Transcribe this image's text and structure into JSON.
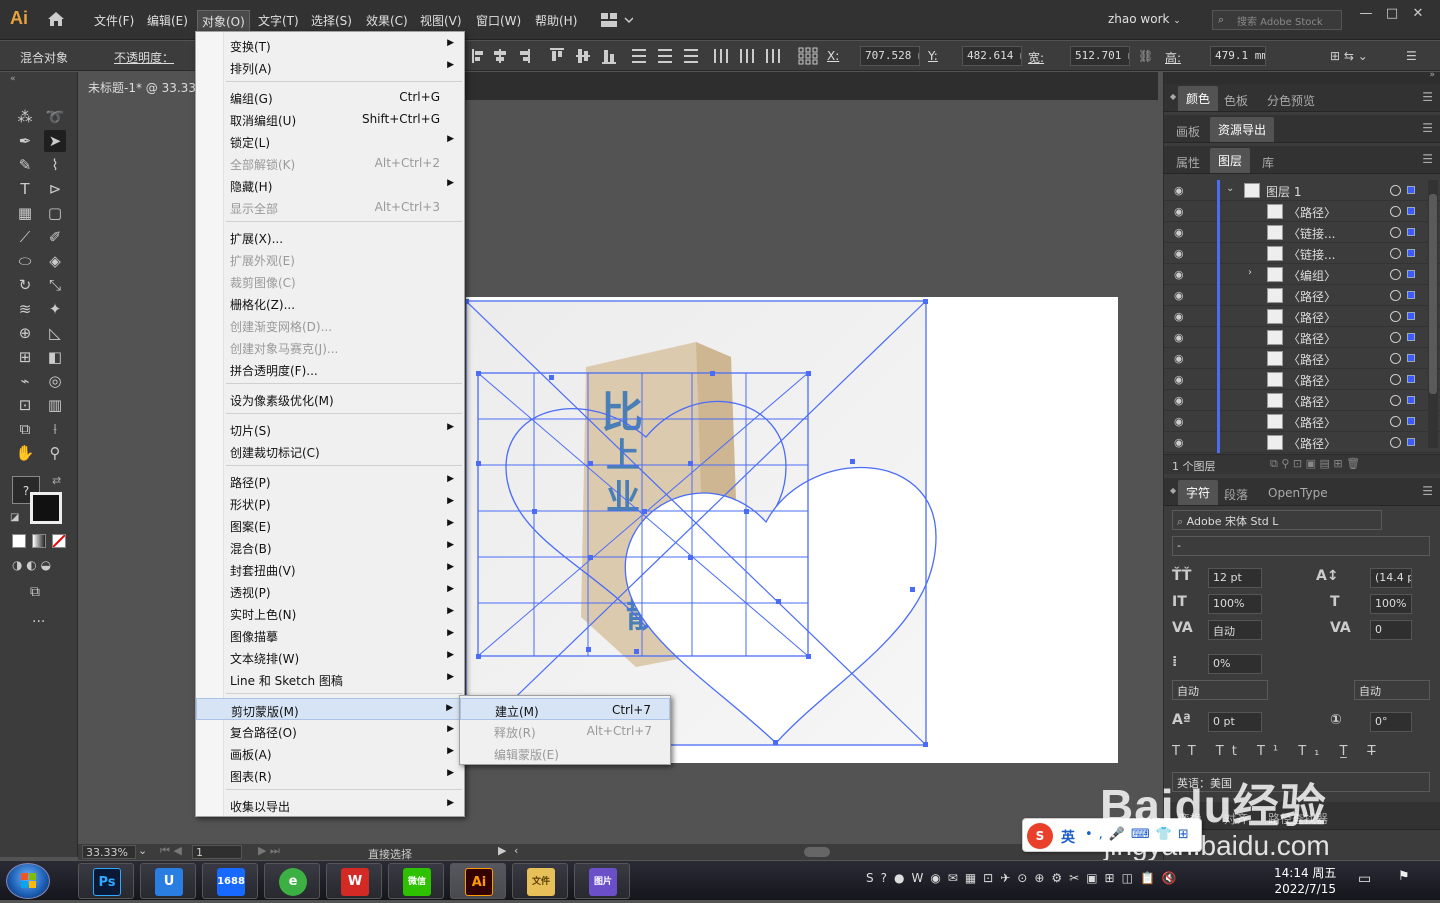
{
  "app": {
    "logo": "Ai",
    "menus": [
      "文件(F)",
      "编辑(E)",
      "对象(O)",
      "文字(T)",
      "选择(S)",
      "效果(C)",
      "视图(V)",
      "窗口(W)",
      "帮助(H)"
    ],
    "active_menu": "对象(O)",
    "workspace": "zhao work",
    "search_placeholder": "搜索 Adobe Stock",
    "window_controls": [
      "—",
      "□",
      "✕"
    ]
  },
  "control_bar": {
    "object_type": "混合对象",
    "opacity_label": "不透明度：",
    "x_label": "X:",
    "x_value": "707.528 m",
    "y_label": "Y:",
    "y_value": "482.614 m",
    "w_label": "宽:",
    "w_value": "512.701 m",
    "h_label": "高:",
    "h_value": "479.1 mm"
  },
  "document": {
    "tab_title": "未标题-1* @ 33.33",
    "zoom": "33.33%",
    "artboard_number": "1",
    "status_tool": "直接选择"
  },
  "object_menu": {
    "items": [
      {
        "label": "变换(T)",
        "shortcut": "",
        "submenu": true,
        "disabled": false
      },
      {
        "label": "排列(A)",
        "shortcut": "",
        "submenu": true,
        "disabled": false
      },
      {
        "sep": true
      },
      {
        "label": "编组(G)",
        "shortcut": "Ctrl+G",
        "submenu": false,
        "disabled": false
      },
      {
        "label": "取消编组(U)",
        "shortcut": "Shift+Ctrl+G",
        "submenu": false,
        "disabled": false
      },
      {
        "label": "锁定(L)",
        "shortcut": "",
        "submenu": true,
        "disabled": false
      },
      {
        "label": "全部解锁(K)",
        "shortcut": "Alt+Ctrl+2",
        "submenu": false,
        "disabled": true
      },
      {
        "label": "隐藏(H)",
        "shortcut": "",
        "submenu": true,
        "disabled": false
      },
      {
        "label": "显示全部",
        "shortcut": "Alt+Ctrl+3",
        "submenu": false,
        "disabled": true
      },
      {
        "sep": true
      },
      {
        "label": "扩展(X)...",
        "shortcut": "",
        "submenu": false,
        "disabled": false
      },
      {
        "label": "扩展外观(E)",
        "shortcut": "",
        "submenu": false,
        "disabled": true
      },
      {
        "label": "裁剪图像(C)",
        "shortcut": "",
        "submenu": false,
        "disabled": true
      },
      {
        "label": "栅格化(Z)...",
        "shortcut": "",
        "submenu": false,
        "disabled": false
      },
      {
        "label": "创建渐变网格(D)...",
        "shortcut": "",
        "submenu": false,
        "disabled": true
      },
      {
        "label": "创建对象马赛克(J)...",
        "shortcut": "",
        "submenu": false,
        "disabled": true
      },
      {
        "label": "拼合透明度(F)...",
        "shortcut": "",
        "submenu": false,
        "disabled": false
      },
      {
        "sep": true
      },
      {
        "label": "设为像素级优化(M)",
        "shortcut": "",
        "submenu": false,
        "disabled": false
      },
      {
        "sep": true
      },
      {
        "label": "切片(S)",
        "shortcut": "",
        "submenu": true,
        "disabled": false
      },
      {
        "label": "创建裁切标记(C)",
        "shortcut": "",
        "submenu": false,
        "disabled": false
      },
      {
        "sep": true
      },
      {
        "label": "路径(P)",
        "shortcut": "",
        "submenu": true,
        "disabled": false
      },
      {
        "label": "形状(P)",
        "shortcut": "",
        "submenu": true,
        "disabled": false
      },
      {
        "label": "图案(E)",
        "shortcut": "",
        "submenu": true,
        "disabled": false
      },
      {
        "label": "混合(B)",
        "shortcut": "",
        "submenu": true,
        "disabled": false
      },
      {
        "label": "封套扭曲(V)",
        "shortcut": "",
        "submenu": true,
        "disabled": false
      },
      {
        "label": "透视(P)",
        "shortcut": "",
        "submenu": true,
        "disabled": false
      },
      {
        "label": "实时上色(N)",
        "shortcut": "",
        "submenu": true,
        "disabled": false
      },
      {
        "label": "图像描摹",
        "shortcut": "",
        "submenu": true,
        "disabled": false
      },
      {
        "label": "文本绕排(W)",
        "shortcut": "",
        "submenu": true,
        "disabled": false
      },
      {
        "label": "Line 和 Sketch 图稿",
        "shortcut": "",
        "submenu": true,
        "disabled": false
      },
      {
        "sep": true
      },
      {
        "label": "剪切蒙版(M)",
        "shortcut": "",
        "submenu": true,
        "disabled": false,
        "highlighted": true
      },
      {
        "label": "复合路径(O)",
        "shortcut": "",
        "submenu": true,
        "disabled": false
      },
      {
        "label": "画板(A)",
        "shortcut": "",
        "submenu": true,
        "disabled": false
      },
      {
        "label": "图表(R)",
        "shortcut": "",
        "submenu": true,
        "disabled": false
      },
      {
        "sep": true
      },
      {
        "label": "收集以导出",
        "shortcut": "",
        "submenu": true,
        "disabled": false
      }
    ]
  },
  "clipping_submenu": {
    "items": [
      {
        "label": "建立(M)",
        "shortcut": "Ctrl+7",
        "disabled": false,
        "highlighted": true
      },
      {
        "label": "释放(R)",
        "shortcut": "Alt+Ctrl+7",
        "disabled": true
      },
      {
        "label": "编辑蒙版(E)",
        "shortcut": "",
        "disabled": true
      }
    ]
  },
  "panels": {
    "tabs_row1": [
      "颜色",
      "色板",
      "分色预览"
    ],
    "tabs_row2": [
      "画板",
      "资源导出"
    ],
    "tabs_row3": [
      "属性",
      "图层",
      "库"
    ],
    "layer_top": "图层 1",
    "layers": [
      "〈路径〉",
      "〈链接...",
      "〈链接...",
      "〈编组〉",
      "〈路径〉",
      "〈路径〉",
      "〈路径〉",
      "〈路径〉",
      "〈路径〉",
      "〈路径〉",
      "〈路径〉",
      "〈路径〉"
    ],
    "layer_count": "1 个图层",
    "char_tabs": [
      "字符",
      "段落",
      "OpenType"
    ],
    "font_family": "Adobe 宋体 Std L",
    "font_style": "-",
    "font_size": "12 pt",
    "leading": "(14.4 p",
    "v_scale": "100%",
    "h_scale": "100%",
    "kerning": "自动",
    "tracking": "0",
    "tsume": "0%",
    "aki_left": "自动",
    "aki_right": "自动",
    "baseline": "0 pt",
    "rotation": "0°",
    "language": "英语：美国",
    "bottom_tabs": [
      "变换",
      "对齐",
      "路径查找器"
    ]
  },
  "taskbar": {
    "apps": [
      "Ps",
      "U",
      "1688",
      "e",
      "W",
      "微信",
      "Ai",
      "文件",
      "图片"
    ],
    "time": "14:14 周五",
    "date": "2022/7/15"
  },
  "ime": {
    "label": "英"
  },
  "watermark": {
    "line1": "Baidu经验",
    "line2": "jingyan.baidu.com"
  },
  "colors": {
    "accent": "#4b6ef0",
    "path_stroke": "#4a6cf7",
    "menu_bg": "#f0f0f0",
    "ui_dark": "#3c3c3c"
  }
}
